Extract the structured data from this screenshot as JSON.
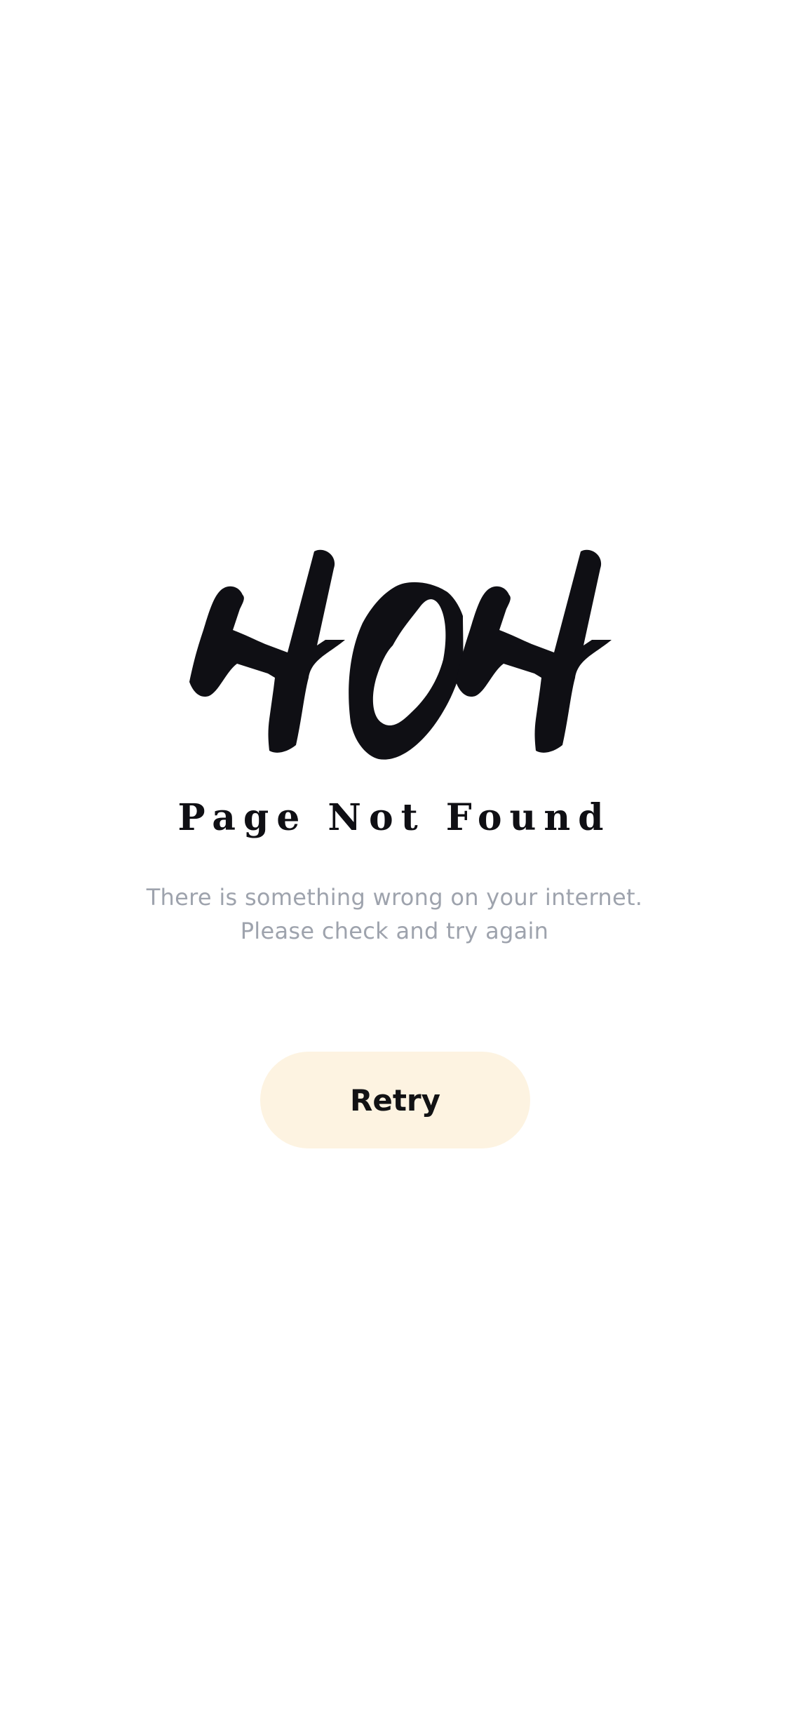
{
  "error": {
    "code": "404",
    "title": "Page Not Found",
    "message_line1": "There is something wrong on your internet.",
    "message_line2": "Please check and try again"
  },
  "actions": {
    "retry_label": "Retry"
  },
  "colors": {
    "background": "#ffffff",
    "graphic": "#0f0f14",
    "title": "#0f0f14",
    "message": "#9ea3ad",
    "button_bg": "#fdf3e1",
    "button_text": "#121214"
  }
}
